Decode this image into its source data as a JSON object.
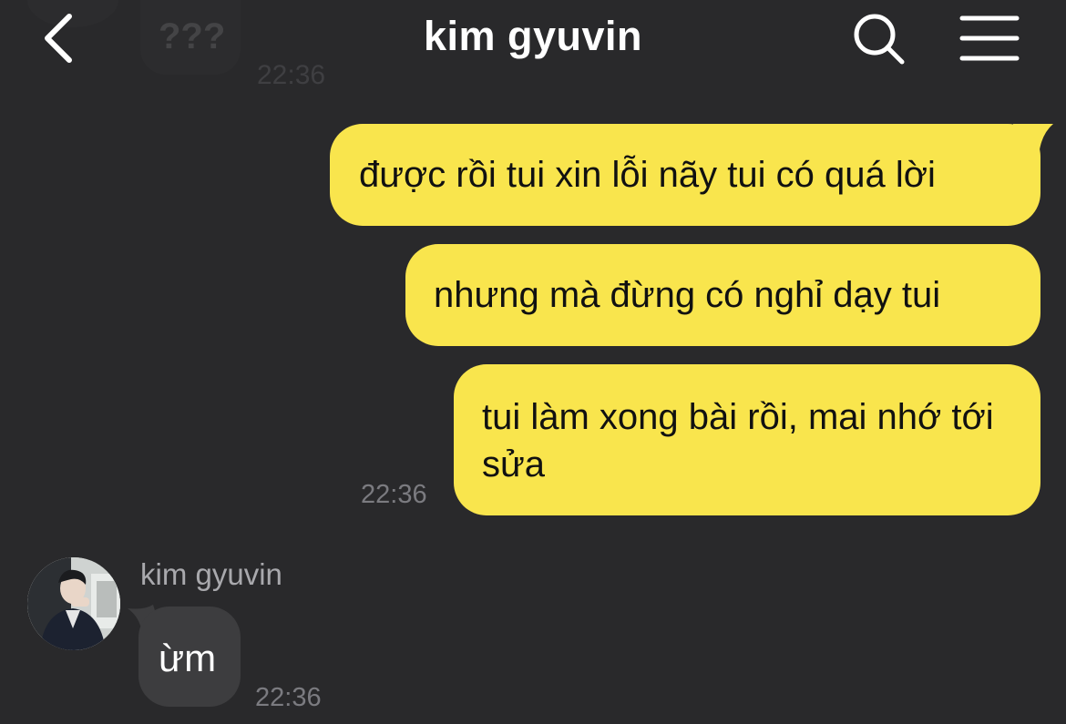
{
  "header": {
    "title": "kim gyuvin",
    "back_icon": "chevron-left-icon",
    "search_icon": "search-icon",
    "menu_icon": "hamburger-menu-icon"
  },
  "previous_message": {
    "text": "???",
    "time": "22:36"
  },
  "outgoing": {
    "messages": [
      "được rồi tui xin lỗi nãy tui có quá lời",
      "nhưng mà đừng có nghỉ dạy tui",
      "tui làm xong bài rồi, mai nhớ tới sửa"
    ],
    "time": "22:36"
  },
  "incoming": {
    "sender": "kim gyuvin",
    "message": "ừm",
    "time": "22:36"
  },
  "colors": {
    "background": "#29292b",
    "outgoing_bubble": "#f9e54d",
    "incoming_bubble": "#3d3d3f",
    "timestamp": "#7b7b80"
  }
}
